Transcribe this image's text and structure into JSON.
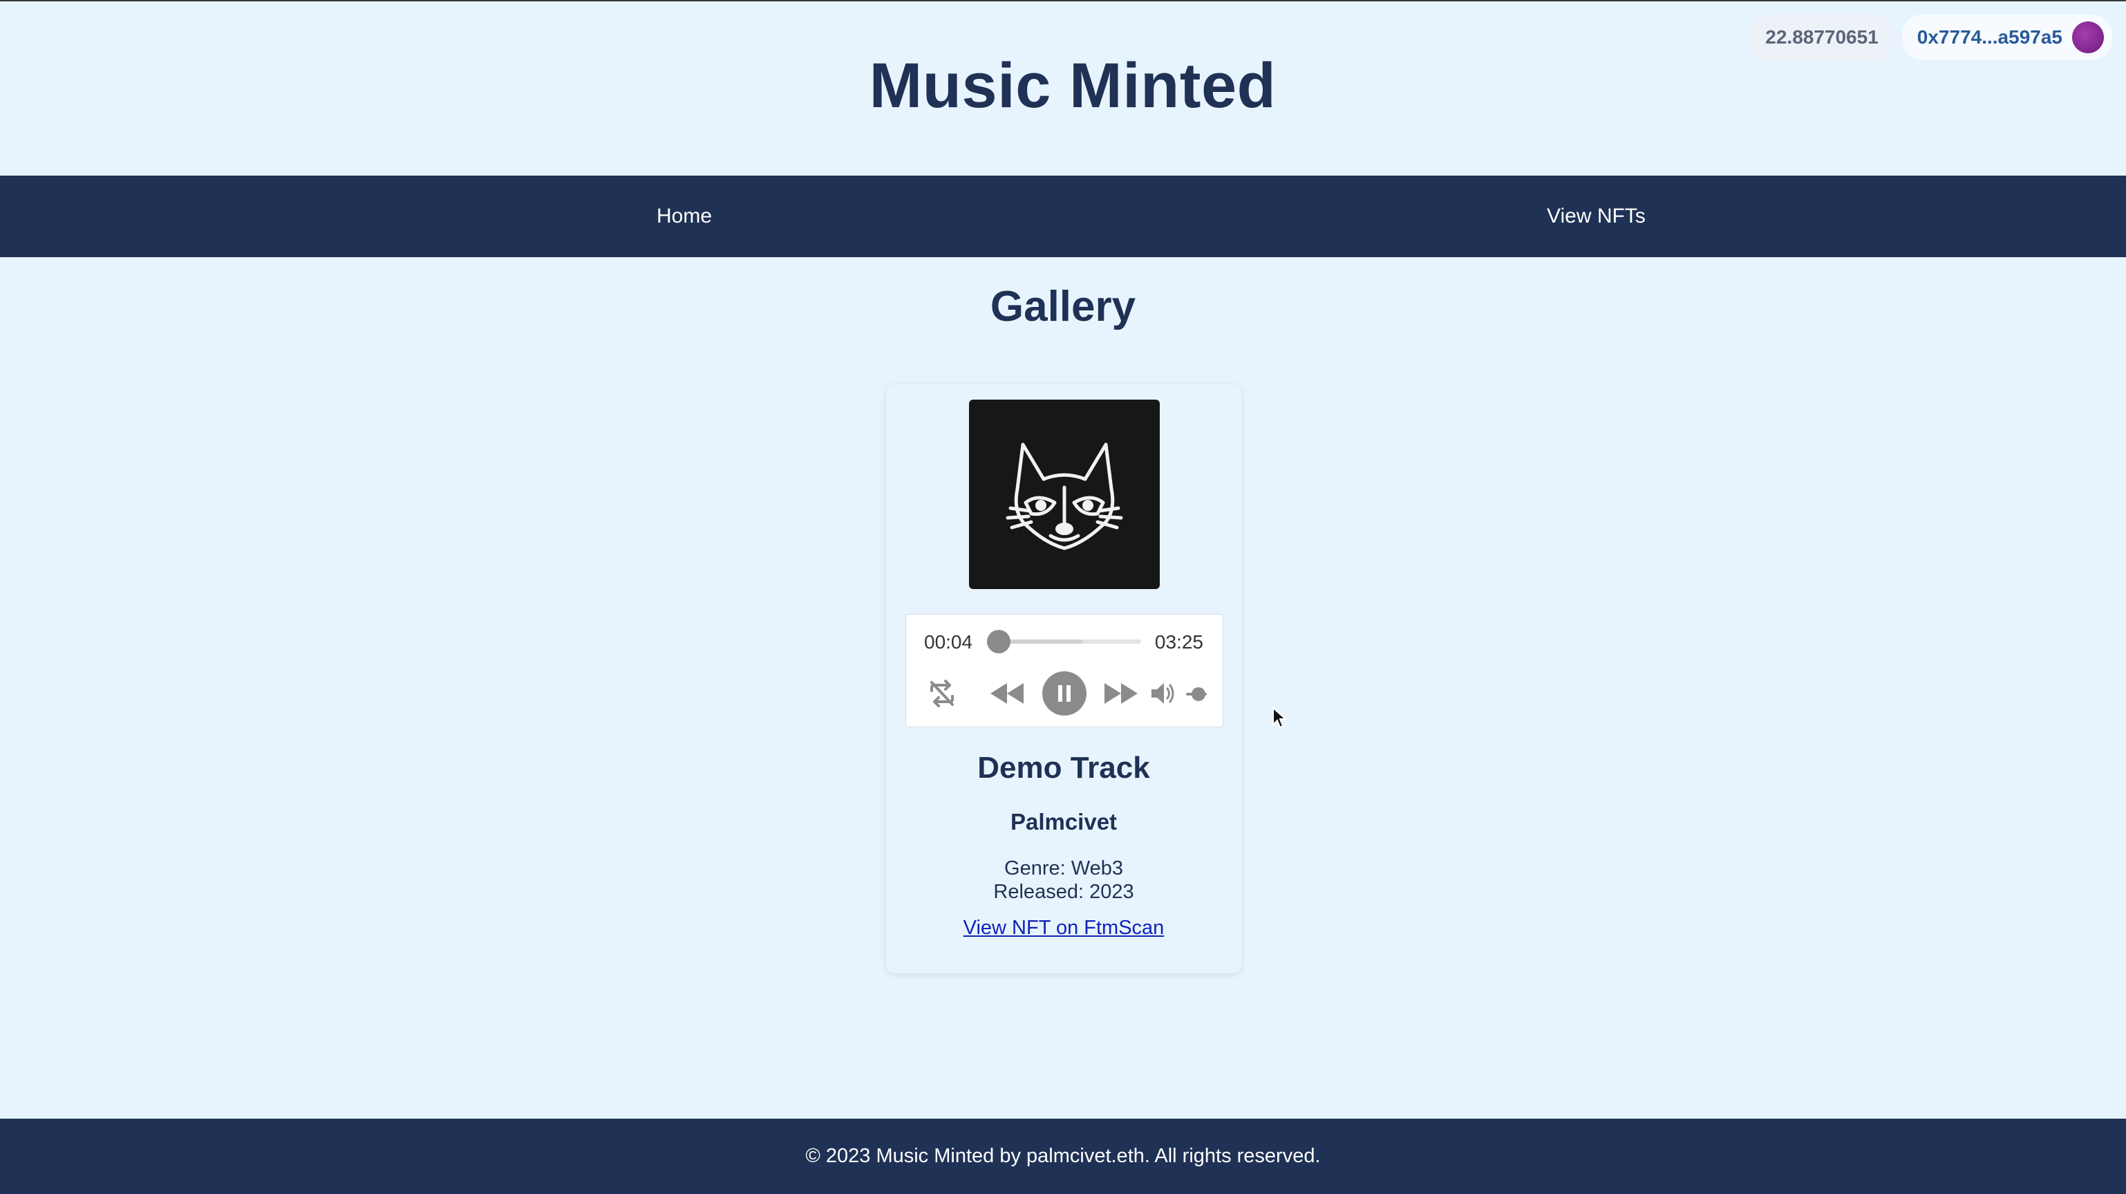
{
  "wallet": {
    "balance": "22.88770651",
    "address": "0x7774...a597a5"
  },
  "header": {
    "title": "Music Minted"
  },
  "nav": {
    "items": [
      {
        "label": "Home"
      },
      {
        "label": "View NFTs"
      }
    ]
  },
  "gallery": {
    "title": "Gallery",
    "card": {
      "cover_icon": "raccoon-face-art",
      "player": {
        "current_time": "00:04",
        "total_time": "03:25",
        "progress_fraction": 0.02,
        "buffered_fraction": 0.6,
        "volume_fraction": 0.6,
        "state": "playing",
        "icons": [
          "repeat-off-icon",
          "rewind-icon",
          "pause-icon",
          "fast-forward-icon",
          "volume-icon"
        ]
      },
      "track_title": "Demo Track",
      "artist": "Palmcivet",
      "genre": "Genre: Web3",
      "released": "Released: 2023",
      "link_label": "View NFT on FtmScan"
    }
  },
  "footer": {
    "text": "© 2023 Music Minted by palmcivet.eth. All rights reserved."
  },
  "colors": {
    "background": "#e8f4fd",
    "navy": "#1f3155",
    "link": "#0f23b8",
    "player_gray": "#8b8b8b"
  }
}
